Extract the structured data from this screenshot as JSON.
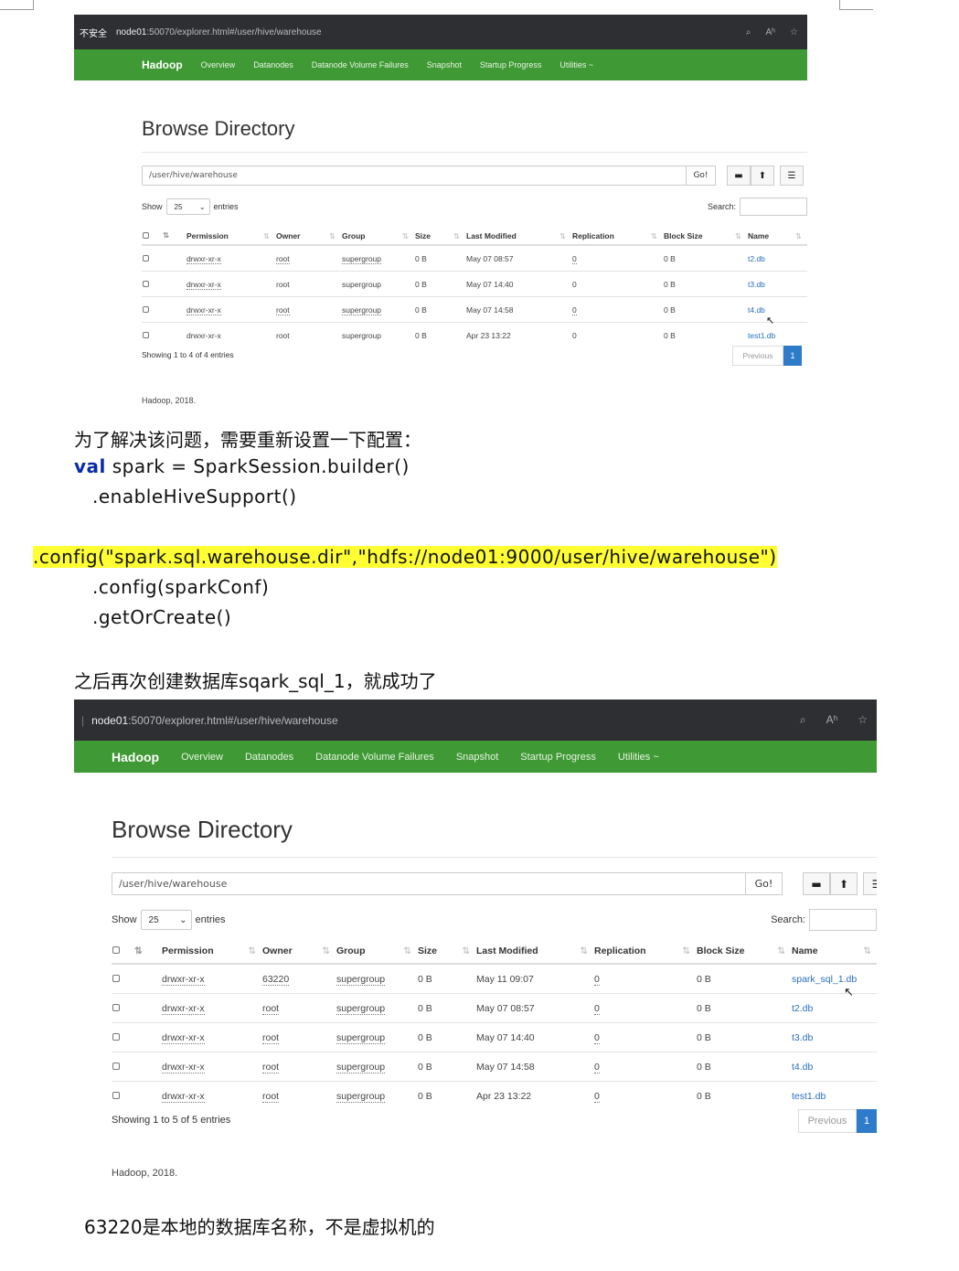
{
  "screenshot_1": {
    "insecure_label": "不安全",
    "url_host": "node01",
    "url_rest": ":50070/explorer.html#/user/hive/warehouse",
    "nav": {
      "brand": "Hadoop",
      "items": [
        "Overview",
        "Datanodes",
        "Datanode Volume Failures",
        "Snapshot",
        "Startup Progress",
        "Utilities ~"
      ]
    },
    "title": "Browse Directory",
    "path_value": "/user/hive/warehouse",
    "go_label": "Go!",
    "show_label": "Show",
    "entries_select": "25",
    "entries_label": "entries",
    "search_label": "Search:",
    "headers": [
      "Permission",
      "Owner",
      "Group",
      "Size",
      "Last Modified",
      "Replication",
      "Block Size",
      "Name"
    ],
    "rows": [
      {
        "permission": "drwxr-xr-x",
        "owner": "root",
        "group": "supergroup",
        "size": "0 B",
        "modified": "May 07 08:57",
        "replication": "0",
        "block": "0 B",
        "name": "t2.db"
      },
      {
        "permission": "drwxr-xr-x",
        "owner": "root",
        "group": "supergroup",
        "size": "0 B",
        "modified": "May 07 14:40",
        "replication": "0",
        "block": "0 B",
        "name": "t3.db"
      },
      {
        "permission": "drwxr-xr-x",
        "owner": "root",
        "group": "supergroup",
        "size": "0 B",
        "modified": "May 07 14:58",
        "replication": "0",
        "block": "0 B",
        "name": "t4.db"
      },
      {
        "permission": "drwxr-xr-x",
        "owner": "root",
        "group": "supergroup",
        "size": "0 B",
        "modified": "Apr 23 13:22",
        "replication": "0",
        "block": "0 B",
        "name": "test1.db"
      }
    ],
    "info": "Showing 1 to 4 of 4 entries",
    "prev_label": "Previous",
    "page": "1",
    "footer": "Hadoop, 2018."
  },
  "text": {
    "line1": "为了解决该问题，需要重新设置一下配置：",
    "code_kw": "val",
    "code_line1": "spark = SparkSession.builder()",
    "code_line2": ".enableHiveSupport()",
    "code_line3": ".config(\"spark.sql.warehouse.dir\",\"hdfs://node01:9000/user/hive/warehouse\")",
    "code_line4": ".config(sparkConf)",
    "code_line5": ".getOrCreate()",
    "line2": "之后再次创建数据库sqark_sql_1，就成功了",
    "line3": "63220是本地的数据库名称，不是虚拟机的"
  },
  "screenshot_2": {
    "url_host": "node01",
    "url_rest": ":50070/explorer.html#/user/hive/warehouse",
    "nav": {
      "brand": "Hadoop",
      "items": [
        "Overview",
        "Datanodes",
        "Datanode Volume Failures",
        "Snapshot",
        "Startup Progress",
        "Utilities ~"
      ]
    },
    "title": "Browse Directory",
    "path_value": "/user/hive/warehouse",
    "go_label": "Go!",
    "show_label": "Show",
    "entries_select": "25",
    "entries_label": "entries",
    "search_label": "Search:",
    "headers": [
      "Permission",
      "Owner",
      "Group",
      "Size",
      "Last Modified",
      "Replication",
      "Block Size",
      "Name"
    ],
    "rows": [
      {
        "permission": "drwxr-xr-x",
        "owner": "63220",
        "group": "supergroup",
        "size": "0 B",
        "modified": "May 11 09:07",
        "replication": "0",
        "block": "0 B",
        "name": "spark_sql_1.db"
      },
      {
        "permission": "drwxr-xr-x",
        "owner": "root",
        "group": "supergroup",
        "size": "0 B",
        "modified": "May 07 08:57",
        "replication": "0",
        "block": "0 B",
        "name": "t2.db"
      },
      {
        "permission": "drwxr-xr-x",
        "owner": "root",
        "group": "supergroup",
        "size": "0 B",
        "modified": "May 07 14:40",
        "replication": "0",
        "block": "0 B",
        "name": "t3.db"
      },
      {
        "permission": "drwxr-xr-x",
        "owner": "root",
        "group": "supergroup",
        "size": "0 B",
        "modified": "May 07 14:58",
        "replication": "0",
        "block": "0 B",
        "name": "t4.db"
      },
      {
        "permission": "drwxr-xr-x",
        "owner": "root",
        "group": "supergroup",
        "size": "0 B",
        "modified": "Apr 23 13:22",
        "replication": "0",
        "block": "0 B",
        "name": "test1.db"
      }
    ],
    "info": "Showing 1 to 5 of 5 entries",
    "prev_label": "Previous",
    "page": "1",
    "footer": "Hadoop, 2018."
  },
  "colors": {
    "navbar": "#3f9934",
    "address_bar": "#2d2f33",
    "link": "#2a6fc0",
    "highlight": "#ffff33",
    "keyword": "#0b2aa8",
    "page_active": "#2e7bc9"
  },
  "icons": [
    "search-icon",
    "read-aloud-icon",
    "favorite-star-icon",
    "folder-icon",
    "upload-icon",
    "list-icon",
    "sort-icon",
    "checkbox-icon",
    "mouse-cursor-icon",
    "dropdown-caret-icon"
  ]
}
